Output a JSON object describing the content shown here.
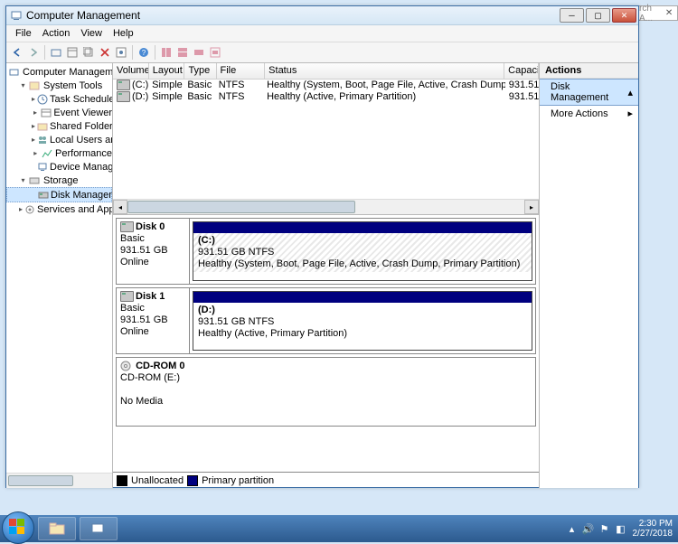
{
  "window": {
    "title": "Computer Management"
  },
  "menus": {
    "file": "File",
    "action": "Action",
    "view": "View",
    "help": "Help"
  },
  "tree": {
    "root": "Computer Management",
    "system_tools": "System Tools",
    "task_scheduler": "Task Scheduler",
    "event_viewer": "Event Viewer",
    "shared_folders": "Shared Folders",
    "local_users": "Local Users and Groups",
    "performance": "Performance",
    "device_manager": "Device Manager",
    "storage": "Storage",
    "disk_management": "Disk Management",
    "services": "Services and Applications"
  },
  "columns": {
    "volume": "Volume",
    "layout": "Layout",
    "type": "Type",
    "fs": "File System",
    "status": "Status",
    "capacity": "Capacity"
  },
  "volumes": [
    {
      "name": "(C:)",
      "layout": "Simple",
      "type": "Basic",
      "fs": "NTFS",
      "status": "Healthy (System, Boot, Page File, Active, Crash Dump, Primary Partition)",
      "capacity": "931.51"
    },
    {
      "name": "(D:)",
      "layout": "Simple",
      "type": "Basic",
      "fs": "NTFS",
      "status": "Healthy (Active, Primary Partition)",
      "capacity": "931.51"
    }
  ],
  "disks": [
    {
      "label": "Disk 0",
      "type": "Basic",
      "size": "931.51 GB",
      "state": "Online",
      "vol": {
        "name": "(C:)",
        "line2": "931.51 GB NTFS",
        "line3": "Healthy (System, Boot, Page File, Active, Crash Dump, Primary Partition)",
        "hatched": true
      }
    },
    {
      "label": "Disk 1",
      "type": "Basic",
      "size": "931.51 GB",
      "state": "Online",
      "vol": {
        "name": "(D:)",
        "line2": "931.51 GB NTFS",
        "line3": "Healthy (Active, Primary Partition)",
        "hatched": false
      }
    },
    {
      "label": "CD-ROM 0",
      "type": "CD-ROM (E:)",
      "size": "",
      "state": "No Media",
      "vol": null
    }
  ],
  "legend": {
    "unallocated": "Unallocated",
    "primary": "Primary partition"
  },
  "actions": {
    "head": "Actions",
    "dm": "Disk Management",
    "more": "More Actions"
  },
  "bg": {
    "search": "rch A..."
  },
  "clock": {
    "time": "2:30 PM",
    "date": "2/27/2018"
  }
}
